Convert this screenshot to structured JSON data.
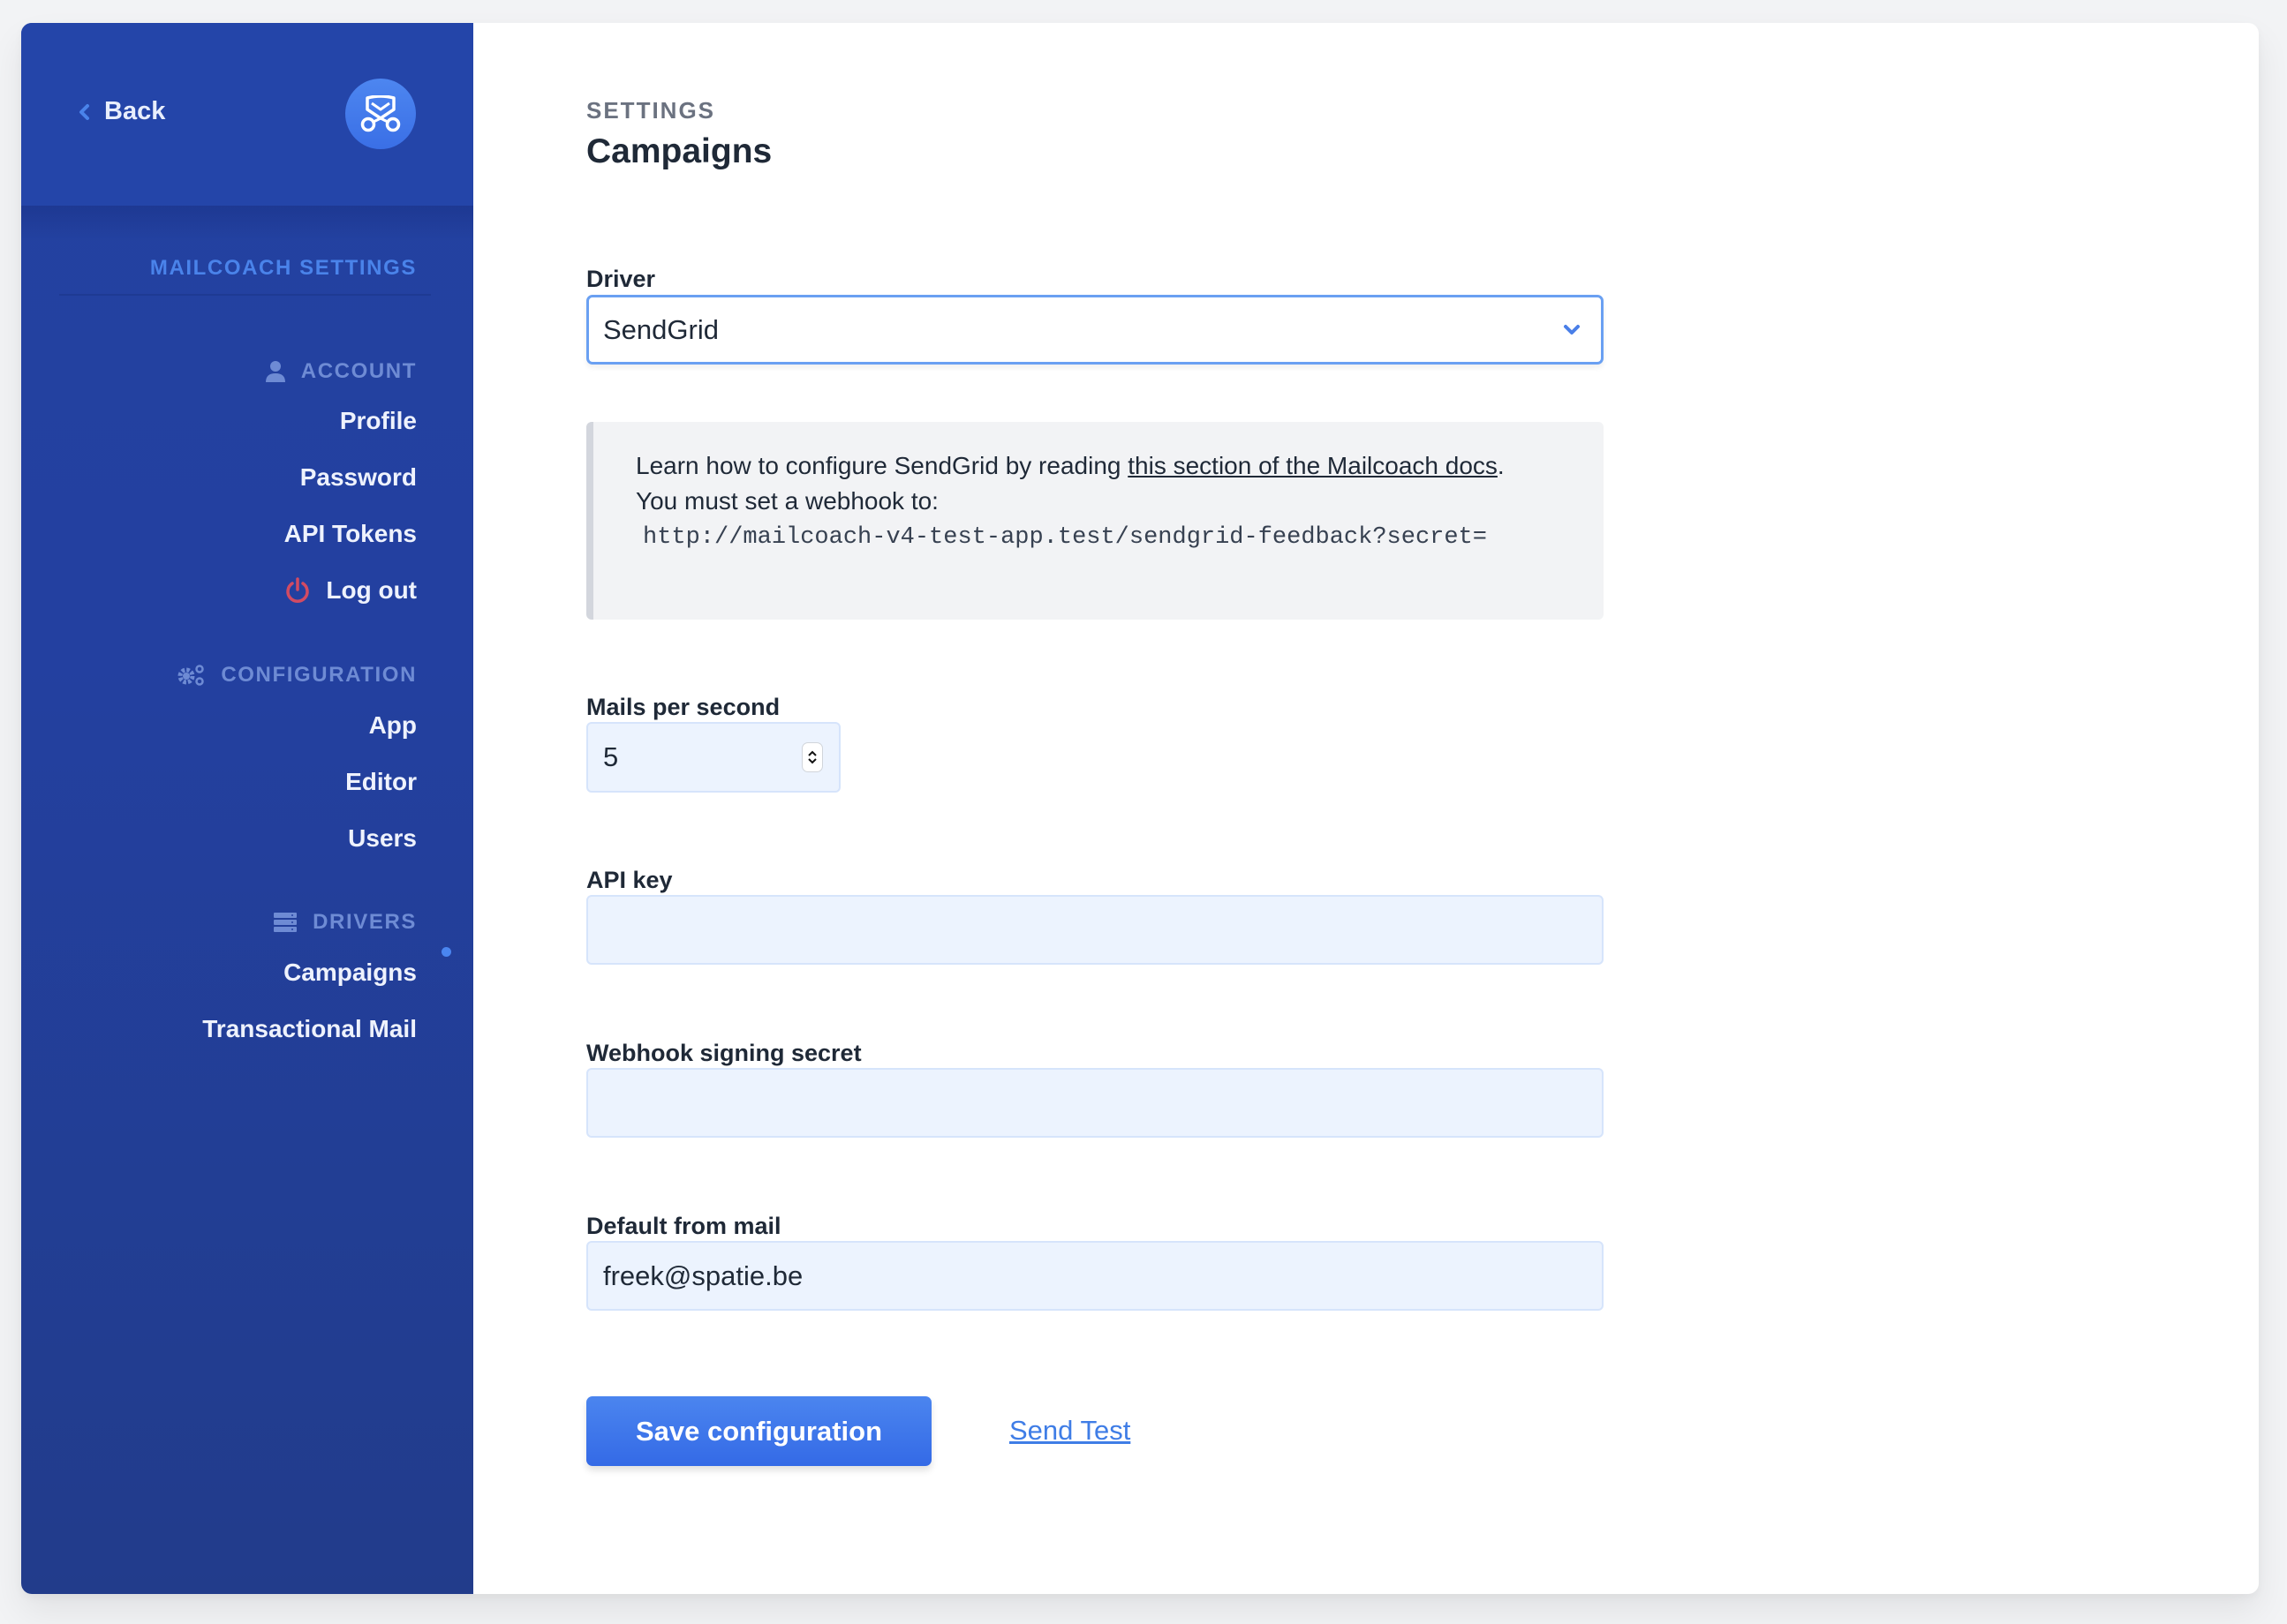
{
  "sidebar": {
    "back_label": "Back",
    "logo_alt": "mailcoach-logo",
    "title": "MAILCOACH SETTINGS",
    "sections": [
      {
        "label": "ACCOUNT",
        "icon": "user-icon",
        "items": [
          {
            "label": "Profile"
          },
          {
            "label": "Password"
          },
          {
            "label": "API Tokens"
          },
          {
            "label": "Log out",
            "icon": "power-icon"
          }
        ]
      },
      {
        "label": "CONFIGURATION",
        "icon": "cogs-icon",
        "items": [
          {
            "label": "App"
          },
          {
            "label": "Editor"
          },
          {
            "label": "Users"
          }
        ]
      },
      {
        "label": "DRIVERS",
        "icon": "server-icon",
        "items": [
          {
            "label": "Campaigns",
            "active": true
          },
          {
            "label": "Transactional Mail"
          }
        ]
      }
    ]
  },
  "main": {
    "eyebrow": "SETTINGS",
    "title": "Campaigns",
    "driver": {
      "label": "Driver",
      "selected": "SendGrid"
    },
    "info": {
      "text_before_link": "Learn how to configure SendGrid by reading ",
      "link_text": "this section of the Mailcoach docs",
      "text_after_link": ".",
      "webhook_text": "You must set a webhook to:",
      "webhook_url": "http://mailcoach-v4-test-app.test/sendgrid-feedback?secret="
    },
    "mails_per_second": {
      "label": "Mails per second",
      "value": "5"
    },
    "api_key": {
      "label": "API key",
      "value": ""
    },
    "webhook_secret": {
      "label": "Webhook signing secret",
      "value": ""
    },
    "default_from_mail": {
      "label": "Default from mail",
      "value": "freek@spatie.be"
    },
    "save_label": "Save configuration",
    "send_test_label": "Send Test"
  },
  "colors": {
    "sidebar": "#2342a1",
    "accent": "#3b74e8",
    "input_bg": "#ecf3fe",
    "logout_icon": "#d24b63"
  }
}
